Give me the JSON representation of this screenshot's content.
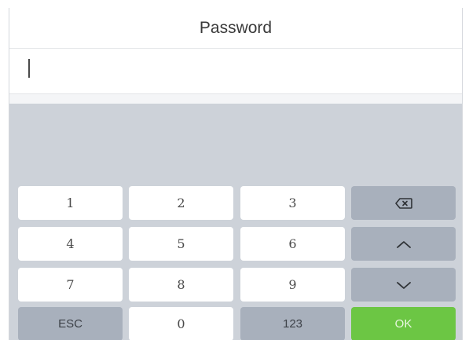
{
  "header": {
    "title": "Password"
  },
  "input": {
    "value": ""
  },
  "keypad": {
    "row1": {
      "k1": "1",
      "k2": "2",
      "k3": "3",
      "action_icon": "backspace-icon"
    },
    "row2": {
      "k1": "4",
      "k2": "5",
      "k3": "6",
      "action_icon": "chevron-up-icon"
    },
    "row3": {
      "k1": "7",
      "k2": "8",
      "k3": "9",
      "action_icon": "chevron-down-icon"
    },
    "row4": {
      "k1": "ESC",
      "k2": "0",
      "k3": "123",
      "k4": "OK"
    }
  },
  "colors": {
    "keypad_background": "#cdd2d9",
    "key_white": "#ffffff",
    "key_gray": "#a8b0bc",
    "ok_green": "#6cc644"
  }
}
